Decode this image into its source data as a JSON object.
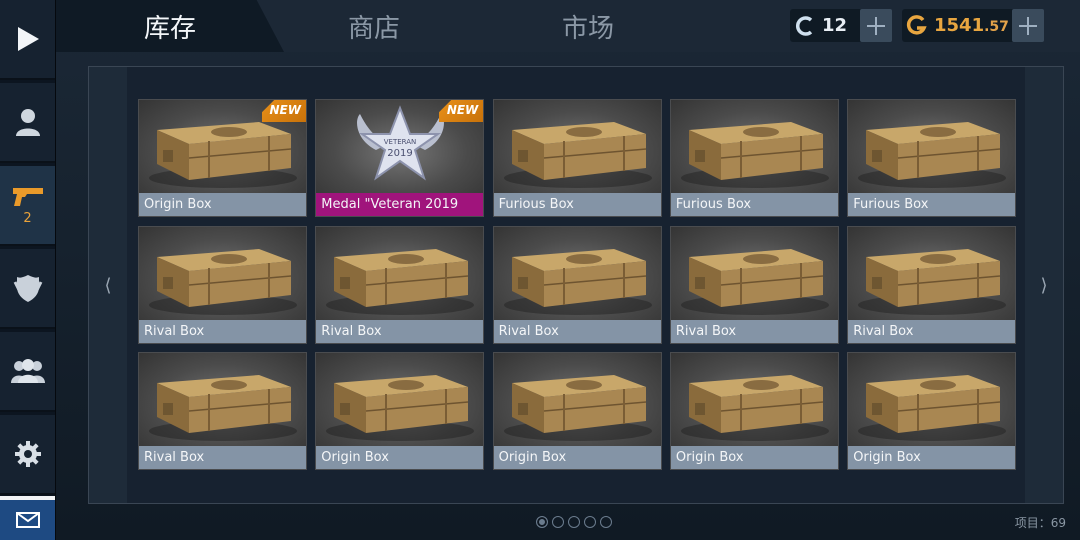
{
  "tabs": [
    {
      "label": "库存",
      "active": true
    },
    {
      "label": "商店",
      "active": false
    },
    {
      "label": "市场",
      "active": false
    }
  ],
  "currency": {
    "credits": {
      "icon": "c-credit-icon",
      "value": "12"
    },
    "gold": {
      "icon": "g-gold-icon",
      "value_int": "1541",
      "value_dec": ".57",
      "color": "#e3a34a"
    }
  },
  "sidebar": {
    "items": [
      {
        "name": "play",
        "icon": "play-icon"
      },
      {
        "name": "profile",
        "icon": "person-icon"
      },
      {
        "name": "weapons",
        "icon": "pistol-icon",
        "badge": "2",
        "active": true
      },
      {
        "name": "clan",
        "icon": "shield-emblem-icon"
      },
      {
        "name": "friends",
        "icon": "group-icon"
      },
      {
        "name": "settings",
        "icon": "gear-icon"
      },
      {
        "name": "mail",
        "icon": "envelope-icon"
      }
    ]
  },
  "inventory": {
    "items": [
      {
        "label": "Origin Box",
        "new": true,
        "type": "box"
      },
      {
        "label": "Medal \"Veteran 2019",
        "new": true,
        "type": "medal"
      },
      {
        "label": "Furious Box",
        "new": false,
        "type": "box"
      },
      {
        "label": "Furious Box",
        "new": false,
        "type": "box"
      },
      {
        "label": "Furious Box",
        "new": false,
        "type": "box"
      },
      {
        "label": "Rival Box",
        "new": false,
        "type": "box"
      },
      {
        "label": "Rival Box",
        "new": false,
        "type": "box"
      },
      {
        "label": "Rival Box",
        "new": false,
        "type": "box"
      },
      {
        "label": "Rival Box",
        "new": false,
        "type": "box"
      },
      {
        "label": "Rival Box",
        "new": false,
        "type": "box"
      },
      {
        "label": "Rival Box",
        "new": false,
        "type": "box"
      },
      {
        "label": "Origin Box",
        "new": false,
        "type": "box"
      },
      {
        "label": "Origin Box",
        "new": false,
        "type": "box"
      },
      {
        "label": "Origin Box",
        "new": false,
        "type": "box"
      },
      {
        "label": "Origin Box",
        "new": false,
        "type": "box"
      }
    ],
    "new_badge": "NEW",
    "medal_text_top": "VETERAN",
    "medal_text_year": "2019",
    "prev_arrow": "⟨",
    "next_arrow": "⟩"
  },
  "pagination": {
    "pages": 5,
    "current": 1
  },
  "item_count": "项目：69"
}
